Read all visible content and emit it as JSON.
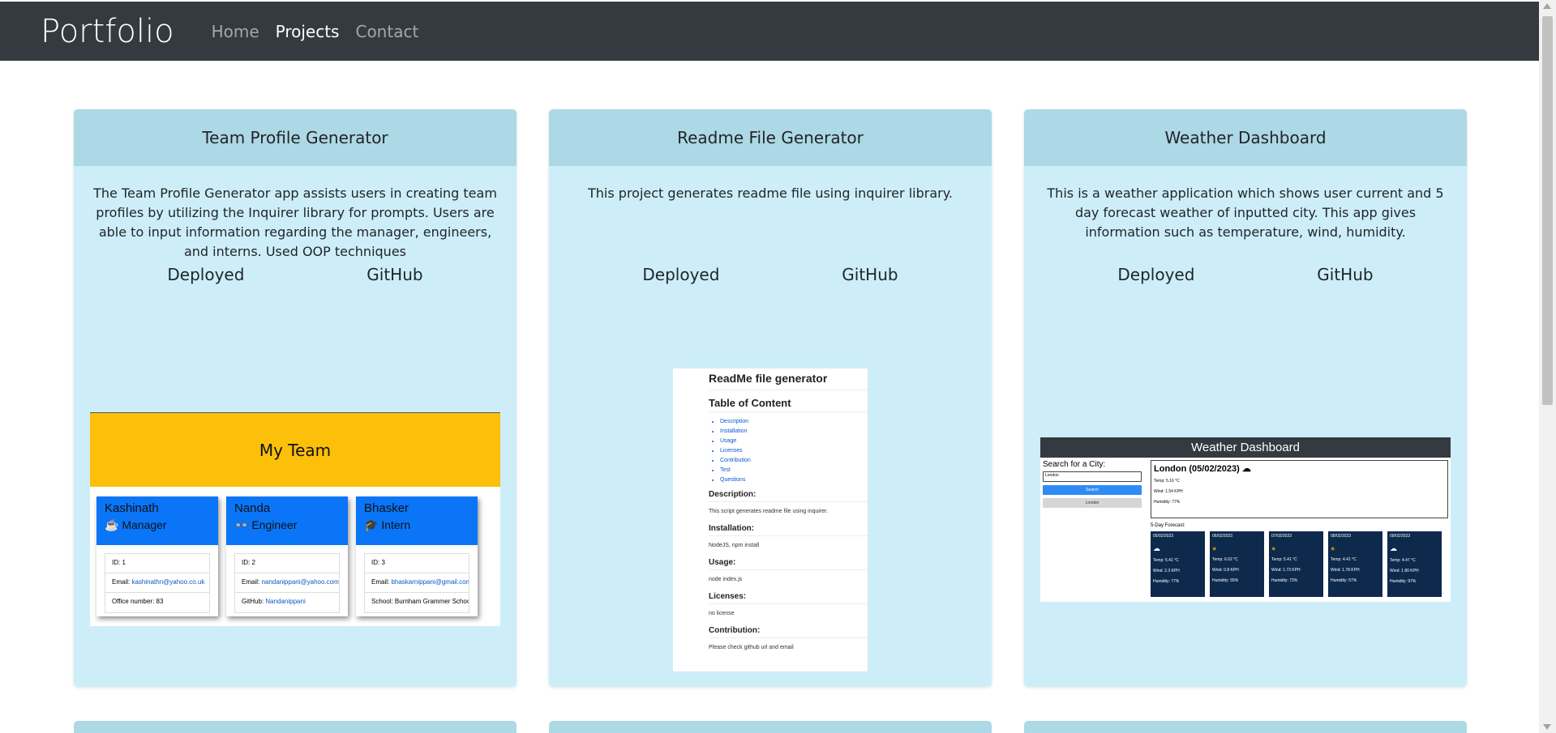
{
  "nav": {
    "brand": "Portfolio",
    "links": [
      {
        "label": "Home"
      },
      {
        "label": "Projects"
      },
      {
        "label": "Contact"
      }
    ]
  },
  "projects": [
    {
      "title": "Team Profile Generator",
      "description": "The Team Profile Generator app assists users in creating team profiles by utilizing the Inquirer library for prompts. Users are able to input information regarding the manager, engineers, and interns. Used OOP techniques",
      "deployed_label": "Deployed",
      "github_label": "GitHub"
    },
    {
      "title": "Readme File Generator",
      "description": "This project generates readme file using inquirer library.",
      "deployed_label": "Deployed",
      "github_label": "GitHub"
    },
    {
      "title": "Weather Dashboard",
      "description": "This is a weather application which shows user current and 5 day forecast weather of inputted city. This app gives information such as temperature, wind, humidity.",
      "deployed_label": "Deployed",
      "github_label": "GitHub"
    }
  ],
  "team_shot": {
    "banner": "My Team",
    "members": [
      {
        "name": "Kashinath",
        "role": "Manager",
        "role_icon": "coffee-icon",
        "id": "ID: 1",
        "email_label": "Email: ",
        "email": "kashinathn@yahoo.co.uk",
        "extra": "Office number: 83",
        "extra_label": "",
        "extra_link": ""
      },
      {
        "name": "Nanda",
        "role": "Engineer",
        "role_icon": "glasses-icon",
        "id": "ID: 2",
        "email_label": "Email: ",
        "email": "nandanippani@yahoo.com",
        "extra": "",
        "extra_label": "GitHub: ",
        "extra_link": "Nandanippani"
      },
      {
        "name": "Bhasker",
        "role": "Intern",
        "role_icon": "graduate-icon",
        "id": "ID: 3",
        "email_label": "Email: ",
        "email": "bhaskarnippani@gmail.com",
        "extra": "School: Burnham Grammer School",
        "extra_label": "",
        "extra_link": ""
      }
    ]
  },
  "readme_shot": {
    "title": "ReadMe file generator",
    "toc_title": "Table of Content",
    "toc": [
      "Description",
      "Installation",
      "Usage",
      "Licenses",
      "Contribution",
      "Test",
      "Questions"
    ],
    "sections": [
      {
        "heading": "Description:",
        "text": "This script generates readme file using inquirer."
      },
      {
        "heading": "Installation:",
        "text": "NodeJS, npm install"
      },
      {
        "heading": "Usage:",
        "text": "node index.js"
      },
      {
        "heading": "Licenses:",
        "text": "no license"
      },
      {
        "heading": "Contribution:",
        "text": "Please check github url and email"
      }
    ]
  },
  "weather_shot": {
    "header": "Weather Dashboard",
    "search_label": "Search for a City:",
    "search_value": "London",
    "search_btn": "Search",
    "history_btn": "London",
    "city": "London (05/02/2023)",
    "temp": "Temp: 5.16 °C",
    "wind": "Wind: 1.54 KPH",
    "humidity": "Humidity: 77%",
    "forecast_title": "5-Day Forecast:",
    "forecast": [
      {
        "date": "05/02/2023",
        "icon": "cloud-icon",
        "temp": "Temp: 5.41 °C",
        "wind": "Wind: 2.3 KPH",
        "humidity": "Humidity: 77%"
      },
      {
        "date": "06/02/2023",
        "icon": "moon-icon",
        "temp": "Temp: 6.02 °C",
        "wind": "Wind: 0.8 KPH",
        "humidity": "Humidity: 55%"
      },
      {
        "date": "07/02/2023",
        "icon": "moon-icon",
        "temp": "Temp: 5.41 °C",
        "wind": "Wind: 1.73 KPH",
        "humidity": "Humidity: 73%"
      },
      {
        "date": "08/02/2023",
        "icon": "moon-icon",
        "temp": "Temp: 4.41 °C",
        "wind": "Wind: 1.78 KPH",
        "humidity": "Humidity: 57%"
      },
      {
        "date": "09/02/2023",
        "icon": "cloud-icon",
        "temp": "Temp: 4.47 °C",
        "wind": "Wind: 1.80 KPH",
        "humidity": "Humidity: 97%"
      }
    ]
  }
}
